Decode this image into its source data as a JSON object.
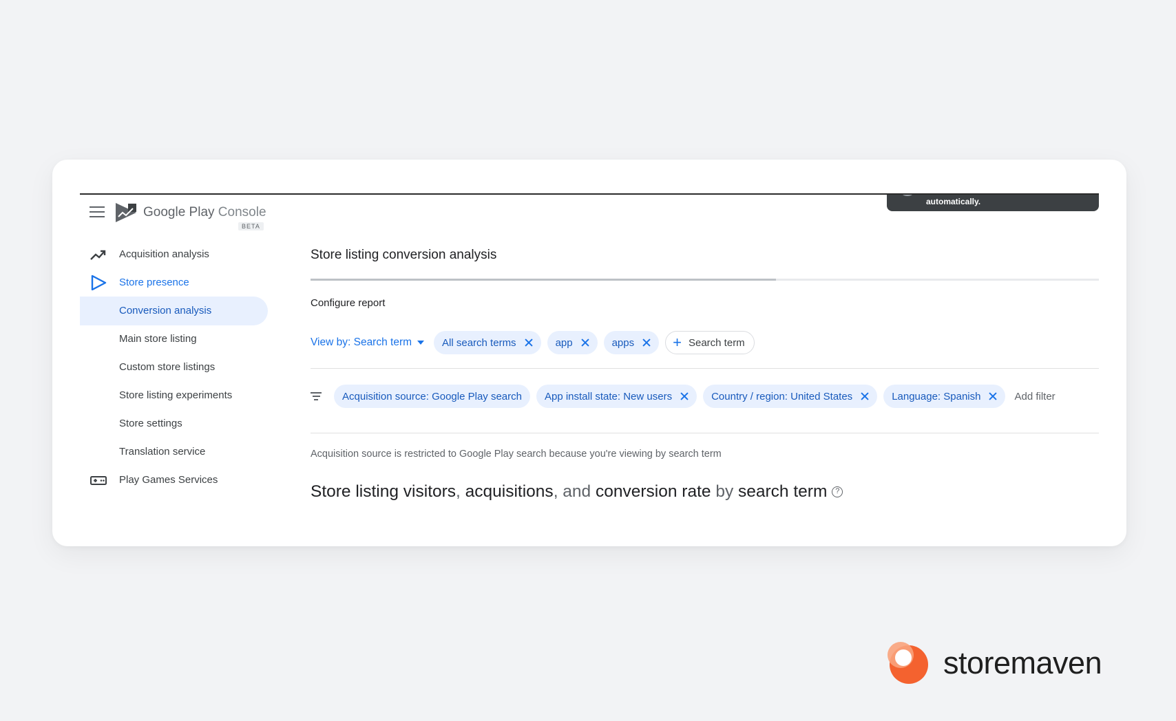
{
  "app": {
    "logo_main": "Google Play",
    "logo_sub": "Console",
    "beta_badge": "BETA"
  },
  "toast": {
    "text": "automatically."
  },
  "sidebar": {
    "items": [
      {
        "label": "Acquisition analysis",
        "icon": "trending-up-icon"
      },
      {
        "label": "Store presence",
        "icon": "play-triangle-icon"
      },
      {
        "label": "Conversion analysis"
      },
      {
        "label": "Main store listing"
      },
      {
        "label": "Custom store listings"
      },
      {
        "label": "Store listing experiments"
      },
      {
        "label": "Store settings"
      },
      {
        "label": "Translation service"
      },
      {
        "label": "Play Games Services",
        "icon": "gamepad-icon"
      }
    ]
  },
  "main": {
    "page_title": "Store listing conversion analysis",
    "section_title": "Configure report",
    "view_by": "View by: Search term",
    "search_chips": [
      "All search terms",
      "app",
      "apps"
    ],
    "add_search_term": "Search term",
    "filter_chips": [
      "Acquisition source: Google Play search",
      "App install state: New users",
      "Country / region: United States",
      "Language: Spanish"
    ],
    "add_filter": "Add filter",
    "note": "Acquisition source is restricted to Google Play search because you're viewing by search term",
    "chart_title": {
      "part1": "Store listing visitors",
      "sep1": ", ",
      "part2": "acquisitions",
      "sep2": ", and ",
      "part3": "conversion rate",
      "sep3": " by ",
      "part4": "search term"
    },
    "help_glyph": "?"
  },
  "brand": {
    "name": "storemaven"
  },
  "colors": {
    "accent": "#1a73e8",
    "chip_bg": "#e8f0fe",
    "brand_orange": "#f4622f"
  }
}
